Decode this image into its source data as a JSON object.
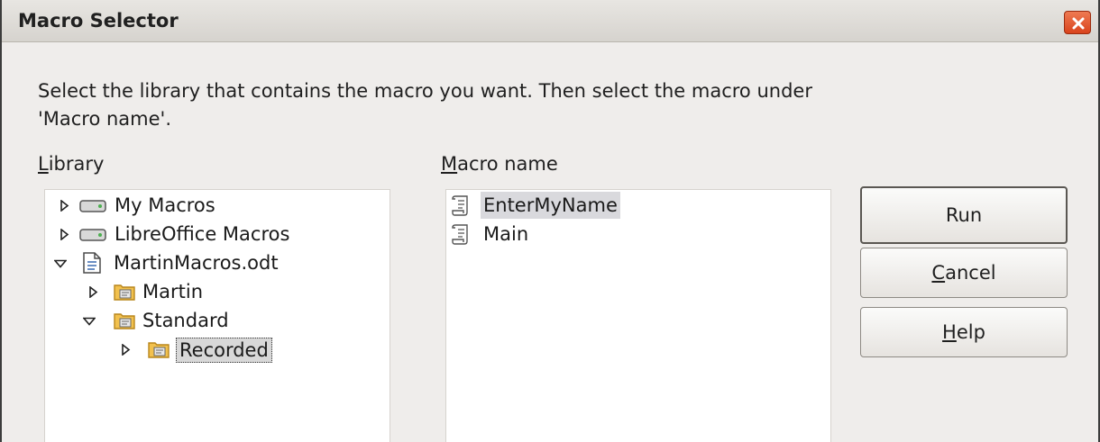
{
  "window": {
    "title": "Macro Selector"
  },
  "instruction": "Select the library that contains the macro you want. Then select the macro under 'Macro name'.",
  "library": {
    "label_first": "L",
    "label_rest": "ibrary",
    "items": [
      {
        "label": "My Macros",
        "icon": "drive-icon",
        "expanded": false
      },
      {
        "label": "LibreOffice Macros",
        "icon": "drive-icon",
        "expanded": false
      },
      {
        "label": "MartinMacros.odt",
        "icon": "document-icon",
        "expanded": true
      },
      {
        "label": "Martin",
        "icon": "library-folder-icon",
        "expanded": false
      },
      {
        "label": "Standard",
        "icon": "library-folder-icon",
        "expanded": true
      },
      {
        "label": "Recorded",
        "icon": "library-folder-icon",
        "expanded": false,
        "selected": true
      }
    ]
  },
  "macro": {
    "label_first": "M",
    "label_rest": "acro name",
    "items": [
      {
        "label": "EnterMyName",
        "icon": "macro-script-icon",
        "selected": true
      },
      {
        "label": "Main",
        "icon": "macro-script-icon",
        "selected": false
      }
    ]
  },
  "buttons": {
    "run": "Run",
    "cancel_first": "C",
    "cancel_rest": "ancel",
    "help_first": "H",
    "help_rest": "elp"
  },
  "colors": {
    "dialog_bg": "#efedeb",
    "close_button": "#d9431c",
    "selection_bg": "#d9d9dd"
  }
}
